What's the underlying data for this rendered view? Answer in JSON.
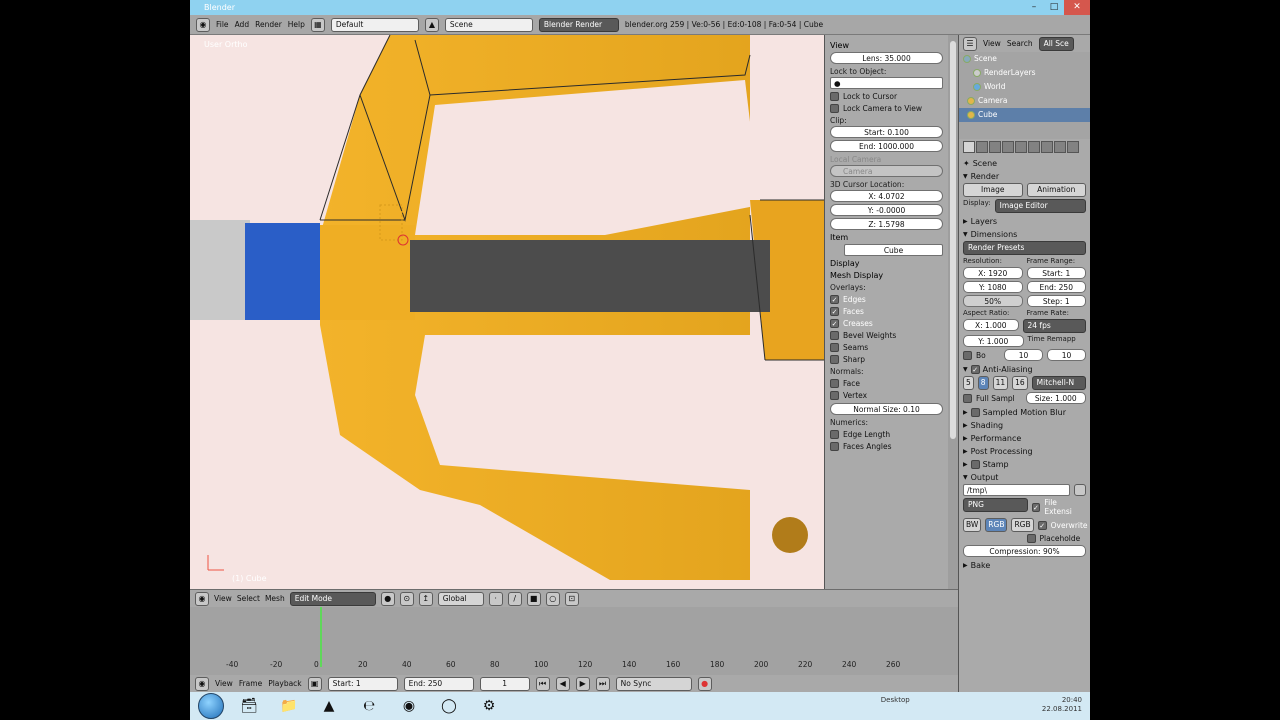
{
  "window": {
    "title": "Blender"
  },
  "info_header": {
    "menus": [
      "File",
      "Add",
      "Render",
      "Help"
    ],
    "layout": "Default",
    "scene": "Scene",
    "engine": "Blender Render",
    "stats": "blender.org 259 | Ve:0-56 | Ed:0-108 | Fa:0-54 | Cube"
  },
  "viewport": {
    "view_label": "User Ortho",
    "object_label": "(1) Cube"
  },
  "view_panel": {
    "view_header": "View",
    "lens": "Lens: 35.000",
    "lock_to_object": "Lock to Object:",
    "lock_to_cursor": "Lock to Cursor",
    "lock_camera": "Lock Camera to View",
    "clip": "Clip:",
    "clip_start": "Start: 0.100",
    "clip_end": "End: 1000.000",
    "local_camera": "Local Camera",
    "camera": "Camera",
    "cursor_location": "3D Cursor Location:",
    "cursor_x": "X: 4.0702",
    "cursor_y": "Y: -0.0000",
    "cursor_z": "Z: 1.5798",
    "item_header": "Item",
    "item_name": "Cube",
    "display_header": "Display",
    "mesh_display_header": "Mesh Display",
    "overlays": "Overlays:",
    "edges": "Edges",
    "faces": "Faces",
    "creases": "Creases",
    "bevel_weights": "Bevel Weights",
    "seams": "Seams",
    "sharp": "Sharp",
    "normals": "Normals:",
    "face": "Face",
    "vertex": "Vertex",
    "normal_size": "Normal Size: 0.10",
    "numerics": "Numerics:",
    "edge_length": "Edge Length",
    "faces_angles": "Faces Angles"
  },
  "vp_header": {
    "menus": [
      "View",
      "Select",
      "Mesh"
    ],
    "mode": "Edit Mode",
    "orientation": "Global"
  },
  "timeline": {
    "ticks": [
      "-40",
      "-20",
      "0",
      "20",
      "40",
      "60",
      "80",
      "100",
      "120",
      "140",
      "160",
      "180",
      "200",
      "220",
      "240",
      "260"
    ],
    "menus": [
      "View",
      "Frame",
      "Playback"
    ],
    "start": "Start: 1",
    "end": "End: 250",
    "current": "1",
    "sync": "No Sync"
  },
  "outliner": {
    "menus": [
      "View",
      "Search",
      "All Sce"
    ],
    "items": [
      "Scene",
      "RenderLayers",
      "World",
      "Camera",
      "Cube"
    ]
  },
  "render": {
    "context": "Scene",
    "render_header": "Render",
    "image_btn": "Image",
    "animation_btn": "Animation",
    "display_label": "Display:",
    "display_value": "Image Editor",
    "layers": "Layers",
    "dimensions": "Dimensions",
    "presets": "Render Presets",
    "resolution": "Resolution:",
    "res_x": "X: 1920",
    "res_y": "Y: 1080",
    "res_pct": "50%",
    "frame_range": "Frame Range:",
    "fr_start": "Start: 1",
    "fr_end": "End: 250",
    "fr_step": "Step: 1",
    "aspect_ratio": "Aspect Ratio:",
    "asp_x": "X: 1.000",
    "asp_y": "Y: 1.000",
    "frame_rate": "Frame Rate:",
    "fps": "24 fps",
    "time_remap": "Time Remapp",
    "border": "Bo",
    "remap_old": "10",
    "remap_new": "10",
    "anti_aliasing": "Anti-Aliasing",
    "aa_samples": [
      "5",
      "8",
      "11",
      "16"
    ],
    "aa_filter": "Mitchell-N",
    "full_sample": "Full Sampl",
    "aa_size": "Size: 1.000",
    "motion_blur": "Sampled Motion Blur",
    "shading": "Shading",
    "performance": "Performance",
    "post_processing": "Post Processing",
    "stamp": "Stamp",
    "output": "Output",
    "output_path": "/tmp\\",
    "file_format": "PNG",
    "file_extensions": "File Extensi",
    "color_modes": [
      "BW",
      "RGB",
      "RGB"
    ],
    "overwrite": "Overwrite",
    "placeholders": "Placeholde",
    "compression": "Compression: 90%",
    "bake": "Bake"
  },
  "taskbar": {
    "desktop": "Desktop",
    "clock_time": "20:40",
    "clock_date": "22.08.2011"
  }
}
